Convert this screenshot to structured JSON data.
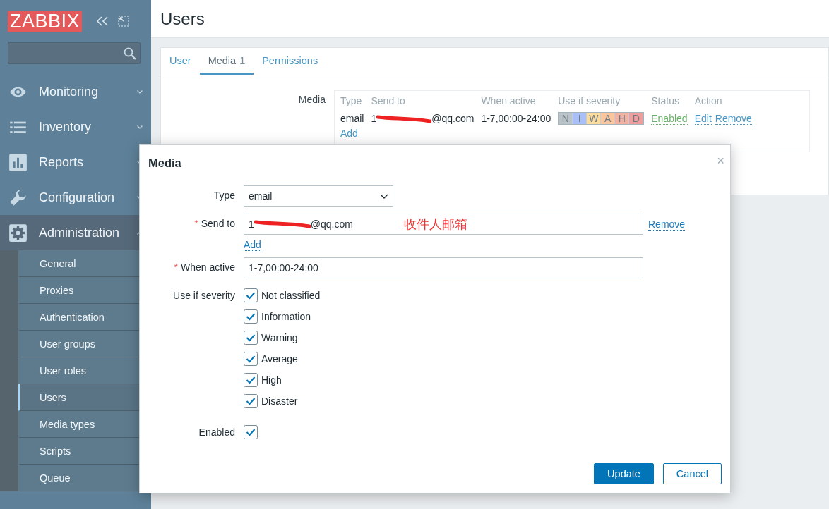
{
  "sidebar": {
    "logo": "ZABBIX",
    "menu": [
      {
        "label": "Monitoring",
        "kind": "eye",
        "expanded": false
      },
      {
        "label": "Inventory",
        "kind": "list",
        "expanded": false
      },
      {
        "label": "Reports",
        "kind": "chart",
        "expanded": false
      },
      {
        "label": "Configuration",
        "kind": "wrench",
        "expanded": false
      },
      {
        "label": "Administration",
        "kind": "gear",
        "expanded": true,
        "children": [
          {
            "label": "General",
            "selected": false
          },
          {
            "label": "Proxies",
            "selected": false
          },
          {
            "label": "Authentication",
            "selected": false
          },
          {
            "label": "User groups",
            "selected": false
          },
          {
            "label": "User roles",
            "selected": false
          },
          {
            "label": "Users",
            "selected": true
          },
          {
            "label": "Media types",
            "selected": false
          },
          {
            "label": "Scripts",
            "selected": false
          },
          {
            "label": "Queue",
            "selected": false
          }
        ]
      }
    ]
  },
  "page": {
    "title": "Users",
    "tabs": [
      {
        "label": "User",
        "selected": false
      },
      {
        "label": "Media",
        "count": "1",
        "selected": true
      },
      {
        "label": "Permissions",
        "selected": false
      }
    ],
    "media_label": "Media",
    "media_table": {
      "columns": [
        "Type",
        "Send to",
        "When active",
        "Use if severity",
        "Status",
        "Action"
      ],
      "rows": [
        {
          "type": "email",
          "send_to_start": "1",
          "send_to_end": "@qq.com",
          "when_active": "1-7,00:00-24:00",
          "severities": [
            {
              "letter": "N",
              "color": "#b9c3c8"
            },
            {
              "letter": "I",
              "color": "#a9bff8"
            },
            {
              "letter": "W",
              "color": "#fcdc9c"
            },
            {
              "letter": "A",
              "color": "#fbc69c"
            },
            {
              "letter": "H",
              "color": "#f2b2a2"
            },
            {
              "letter": "D",
              "color": "#ef9d9d"
            }
          ],
          "status": "Enabled",
          "actions": [
            "Edit",
            "Remove"
          ]
        }
      ],
      "add": "Add"
    }
  },
  "dialog": {
    "title": "Media",
    "close": "×",
    "type": {
      "label": "Type",
      "value": "email"
    },
    "send_to": {
      "label": "Send to",
      "required_mark": "*",
      "value_start": "1",
      "value_end": "@qq.com",
      "annotation": "收件人邮箱",
      "remove": "Remove",
      "add": "Add"
    },
    "when_active": {
      "label": "When active",
      "required_mark": "*",
      "value": "1-7,00:00-24:00"
    },
    "severity": {
      "label": "Use if severity",
      "options": [
        {
          "label": "Not classified",
          "checked": true
        },
        {
          "label": "Information",
          "checked": true
        },
        {
          "label": "Warning",
          "checked": true
        },
        {
          "label": "Average",
          "checked": true
        },
        {
          "label": "High",
          "checked": true
        },
        {
          "label": "Disaster",
          "checked": true
        }
      ]
    },
    "enabled": {
      "label": "Enabled",
      "checked": true
    },
    "buttons": [
      {
        "label": "Update",
        "kind": "primary"
      },
      {
        "label": "Cancel",
        "kind": "secondary"
      }
    ]
  }
}
